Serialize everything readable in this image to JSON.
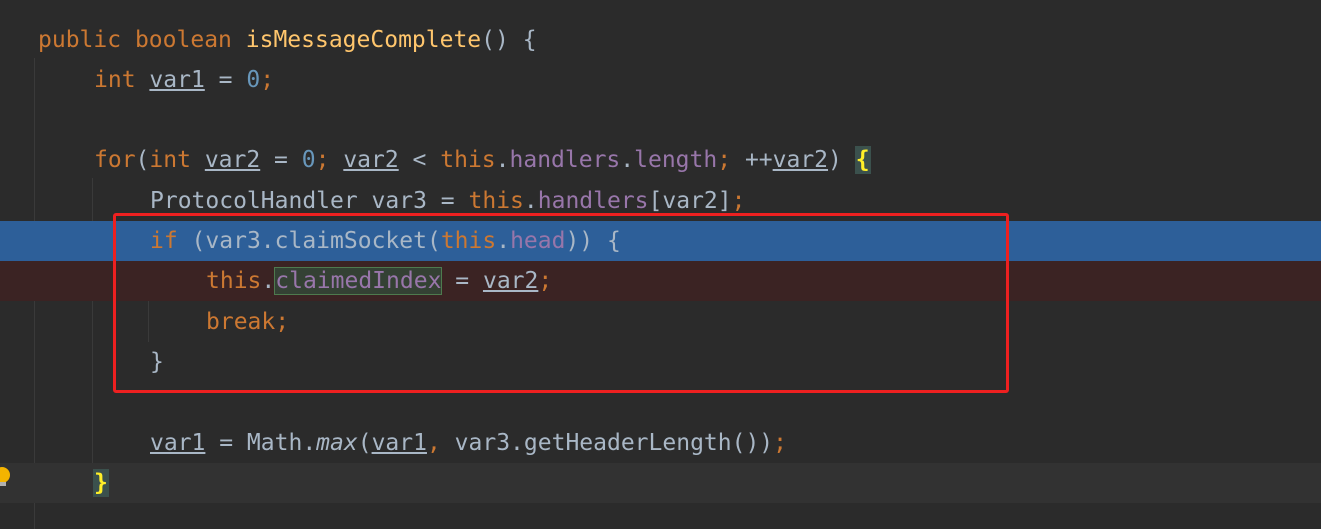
{
  "code": {
    "l1": {
      "kw1": "public",
      "kw2": "boolean",
      "method": "isMessageComplete",
      "rest": "() {"
    },
    "l2": {
      "kw": "int",
      "var": "var1",
      "eq": " = ",
      "num": "0",
      "semi": ";"
    },
    "l4": {
      "kw_for": "for",
      "open": "(",
      "kw_int": "int",
      "var_a": "var2",
      "eq": " = ",
      "num": "0",
      "semi1": "; ",
      "var_b": "var2",
      "lt": " < ",
      "kw_this": "this",
      "dot1": ".",
      "fld_handlers": "handlers",
      "dot2": ".",
      "fld_length": "length",
      "semi2": "; ",
      "inc": "++",
      "var_c": "var2",
      "close": ") ",
      "brace": "{"
    },
    "l5": {
      "type": "ProtocolHandler var3 = ",
      "kw_this": "this",
      "dot": ".",
      "fld": "handlers",
      "rest": "[var2]",
      "semi": ";"
    },
    "l6": {
      "kw_if": "if",
      "pre": " (var3.claimSocket(",
      "kw_this": "this",
      "dot": ".",
      "fld": "head",
      "post": ")) {"
    },
    "l7": {
      "kw_this": "this",
      "dot": ".",
      "fld": "claimedIndex",
      "eq": " = ",
      "var": "var2",
      "semi": ";"
    },
    "l8": {
      "kw": "break",
      "semi": ";"
    },
    "l9": {
      "brace": "}"
    },
    "l11": {
      "var_a": "var1",
      "eq": " = Math.",
      "method": "max",
      "open": "(",
      "var_b": "var1",
      "comma": ", ",
      "rest": "var3.getHeaderLength())",
      "semi": ";"
    },
    "l12": {
      "brace": "}"
    }
  },
  "colors": {
    "background": "#2b2b2b",
    "keyword": "#cc7832",
    "method": "#ffc66d",
    "number": "#6897bb",
    "field": "#9876aa",
    "text": "#a9b7c6",
    "current_line": "#2d5f99",
    "breakpoint_line": "#3b2323",
    "annotation_box": "#ee2020"
  },
  "gutter": {
    "icon": "lightbulb-icon"
  }
}
